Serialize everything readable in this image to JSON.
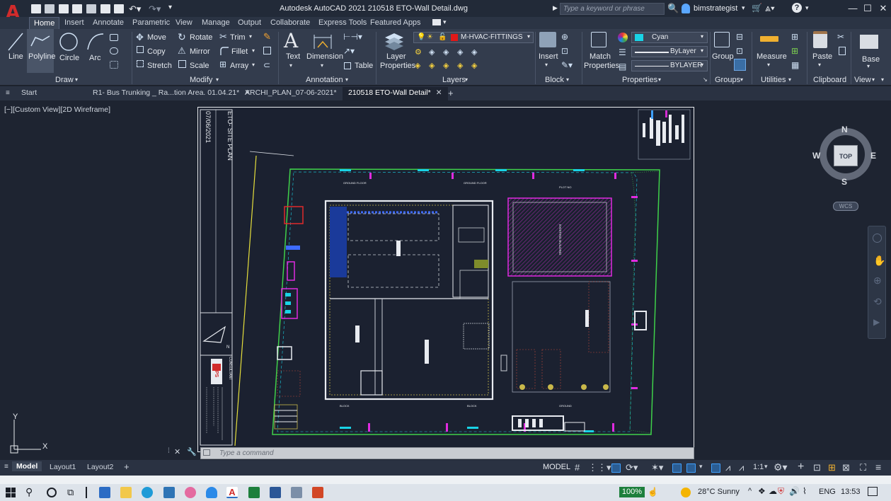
{
  "title_bar": {
    "app_logo": "A",
    "title": "Autodesk AutoCAD 2021    210518 ETO-Wall Detail.dwg",
    "search_placeholder": "Type a keyword or phrase",
    "user": "bimstrategist"
  },
  "ribbon_tabs": [
    "Home",
    "Insert",
    "Annotate",
    "Parametric",
    "View",
    "Manage",
    "Output",
    "Collaborate",
    "Express Tools",
    "Featured Apps"
  ],
  "ribbon": {
    "draw": {
      "title": "Draw",
      "tools": [
        "Line",
        "Polyline",
        "Circle",
        "Arc"
      ]
    },
    "modify": {
      "title": "Modify",
      "tools": [
        "Move",
        "Rotate",
        "Trim",
        "Copy",
        "Mirror",
        "Fillet",
        "Stretch",
        "Scale",
        "Array"
      ]
    },
    "annotation": {
      "title": "Annotation",
      "tools": [
        "Text",
        "Dimension",
        "Table"
      ]
    },
    "layers": {
      "title": "Layers",
      "layer_properties": "Layer Properties",
      "current_layer": "M-HVAC-FITTINGS",
      "layer_color": "#e01818"
    },
    "block": {
      "title": "Block",
      "insert": "Insert"
    },
    "properties": {
      "title": "Properties",
      "match": "Match Properties",
      "color": "Cyan",
      "color_hex": "#19d3e6",
      "linetype": "ByLayer",
      "lineweight": "BYLAYER"
    },
    "groups": {
      "title": "Groups",
      "group": "Group"
    },
    "utilities": {
      "title": "Utilities",
      "measure": "Measure"
    },
    "clipboard": {
      "title": "Clipboard",
      "paste": "Paste"
    },
    "view": {
      "title": "View",
      "base": "Base"
    }
  },
  "doc_tabs": [
    {
      "label": "Start"
    },
    {
      "label": "R1- Bus Trunking _ Ra...tion Area. 01.04.21*"
    },
    {
      "label": "ARCHI_PLAN_07-06-2021*"
    },
    {
      "label": "210518 ETO-Wall Detail*"
    }
  ],
  "viewport": {
    "label": "[−][Custom View][2D Wireframe]",
    "sheet_date": "07/06/2021",
    "sheet_title": "ETO- SITE PLAN",
    "consultant": "CONSULTANT",
    "logo_text": "MPS",
    "existing_building": "EXISTING BUILDING",
    "north": "N"
  },
  "viewcube": {
    "n": "N",
    "s": "S",
    "e": "E",
    "w": "W",
    "top": "TOP",
    "wcs": "WCS"
  },
  "ucs": {
    "x": "X",
    "y": "Y"
  },
  "command_placeholder": "Type a command",
  "layout_tabs": [
    "Model",
    "Layout1",
    "Layout2"
  ],
  "status": {
    "model": "MODEL",
    "scale": "1:1"
  },
  "taskbar": {
    "zoom": "100%",
    "weather": "28°C  Sunny",
    "lang": "ENG",
    "time": "13:53"
  }
}
